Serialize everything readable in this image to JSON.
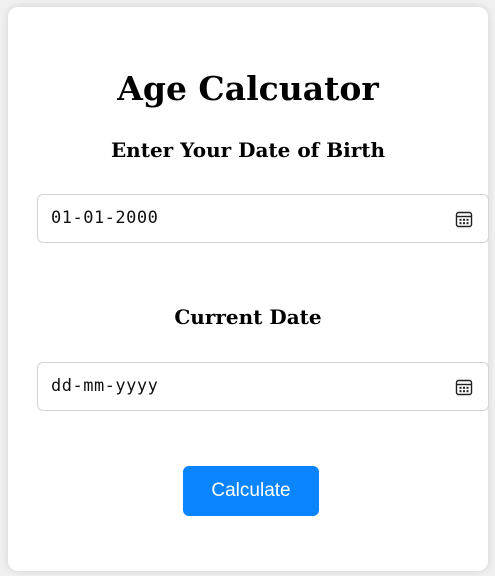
{
  "app": {
    "title": "Age Calcuator"
  },
  "birth": {
    "label": "Enter Your Date of Birth",
    "value": "01-01-2000",
    "icon": "calendar-icon"
  },
  "current": {
    "label": "Current Date",
    "placeholder": "dd-mm-yyyy",
    "icon": "calendar-icon"
  },
  "actions": {
    "calculate_label": "Calculate"
  },
  "colors": {
    "accent": "#0a84ff",
    "card": "#ffffff",
    "background": "#f0f0f0",
    "border": "#d4d4d4"
  }
}
